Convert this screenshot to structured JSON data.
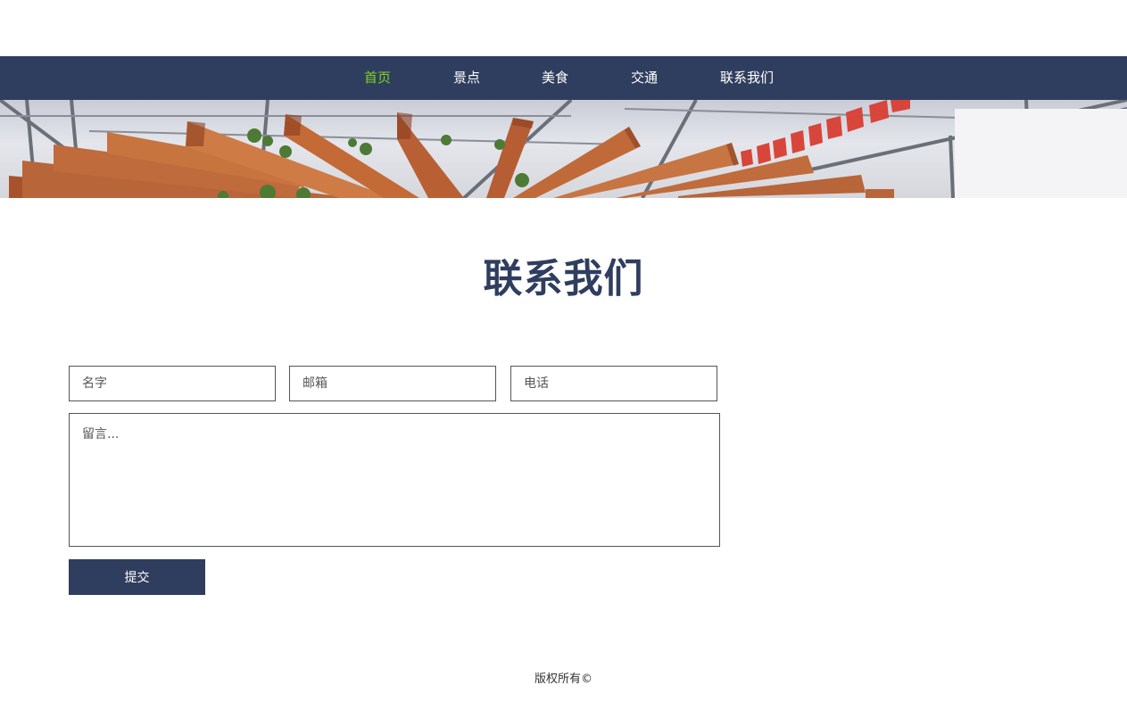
{
  "nav": {
    "items": [
      {
        "label": "首页",
        "active": true
      },
      {
        "label": "景点",
        "active": false
      },
      {
        "label": "美食",
        "active": false
      },
      {
        "label": "交通",
        "active": false
      },
      {
        "label": "联系我们",
        "active": false
      }
    ],
    "background_color": "#2f3e5e",
    "active_color": "#7ed321"
  },
  "banner": {
    "description": "greenhouse interior with wooden beams and red flags"
  },
  "contact": {
    "title": "联系我们",
    "name_placeholder": "名字",
    "email_placeholder": "邮箱",
    "phone_placeholder": "电话",
    "message_placeholder": "留言...",
    "submit_label": "提交"
  },
  "footer": {
    "copyright": "版权所有©"
  }
}
